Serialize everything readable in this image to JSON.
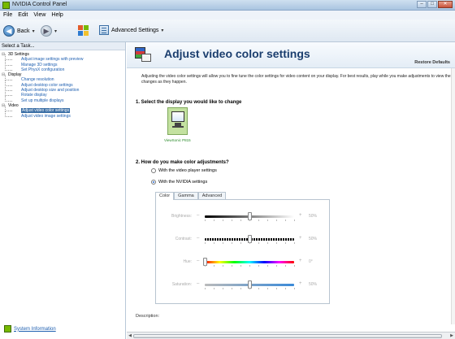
{
  "window": {
    "title": "NVIDIA Control Panel"
  },
  "menu": [
    "File",
    "Edit",
    "View",
    "Help"
  ],
  "toolbar": {
    "back_label": "Back",
    "forward_label": "",
    "advanced_label": "Advanced Settings"
  },
  "left": {
    "header": "Select a Task...",
    "tree": [
      {
        "type": "cat",
        "label": "3D Settings"
      },
      {
        "type": "leaf",
        "label": "Adjust image settings with preview"
      },
      {
        "type": "leaf",
        "label": "Manage 3D settings"
      },
      {
        "type": "leaf",
        "label": "Set PhysX configuration"
      },
      {
        "type": "cat",
        "label": "Display"
      },
      {
        "type": "leaf",
        "label": "Change resolution"
      },
      {
        "type": "leaf",
        "label": "Adjust desktop color settings"
      },
      {
        "type": "leaf",
        "label": "Adjust desktop size and position"
      },
      {
        "type": "leaf",
        "label": "Rotate display"
      },
      {
        "type": "leaf",
        "label": "Set up multiple displays"
      },
      {
        "type": "cat",
        "label": "Video"
      },
      {
        "type": "leaf",
        "label": "Adjust video color settings",
        "selected": true
      },
      {
        "type": "leaf",
        "label": "Adjust video image settings"
      }
    ],
    "system_info": "System Information"
  },
  "main": {
    "title": "Adjust video color settings",
    "restore": "Restore Defaults",
    "intro": "Adjusting the video color settings will allow you to fine tune the color settings for video content on your display. For best results, play while you make adjustments to view the changes as they happen.",
    "section1": "1. Select the display you would like to change",
    "display_label": "ViewSonic P815",
    "section2": "2. How do you make color adjustments?",
    "radio1": "With the video player settings",
    "radio2": "With the NVIDIA settings",
    "radio_selected": 1,
    "tabs": [
      "Color",
      "Gamma",
      "Advanced"
    ],
    "active_tab": 0,
    "sliders": [
      {
        "label": "Brightness:",
        "value": "50%",
        "level": 0.5,
        "style": "gray"
      },
      {
        "label": "Contrast:",
        "value": "50%",
        "level": 0.5,
        "style": "contrast"
      },
      {
        "label": "Hue:",
        "value": "0°",
        "level": 0.0,
        "style": "hue"
      },
      {
        "label": "Saturation:",
        "value": "50%",
        "level": 0.5,
        "style": "sat"
      }
    ],
    "description_label": "Description:"
  },
  "colors": {
    "accent": "#3a6ea5",
    "nvidia_green": "#76b900",
    "title_blue": "#1b3e6e"
  }
}
